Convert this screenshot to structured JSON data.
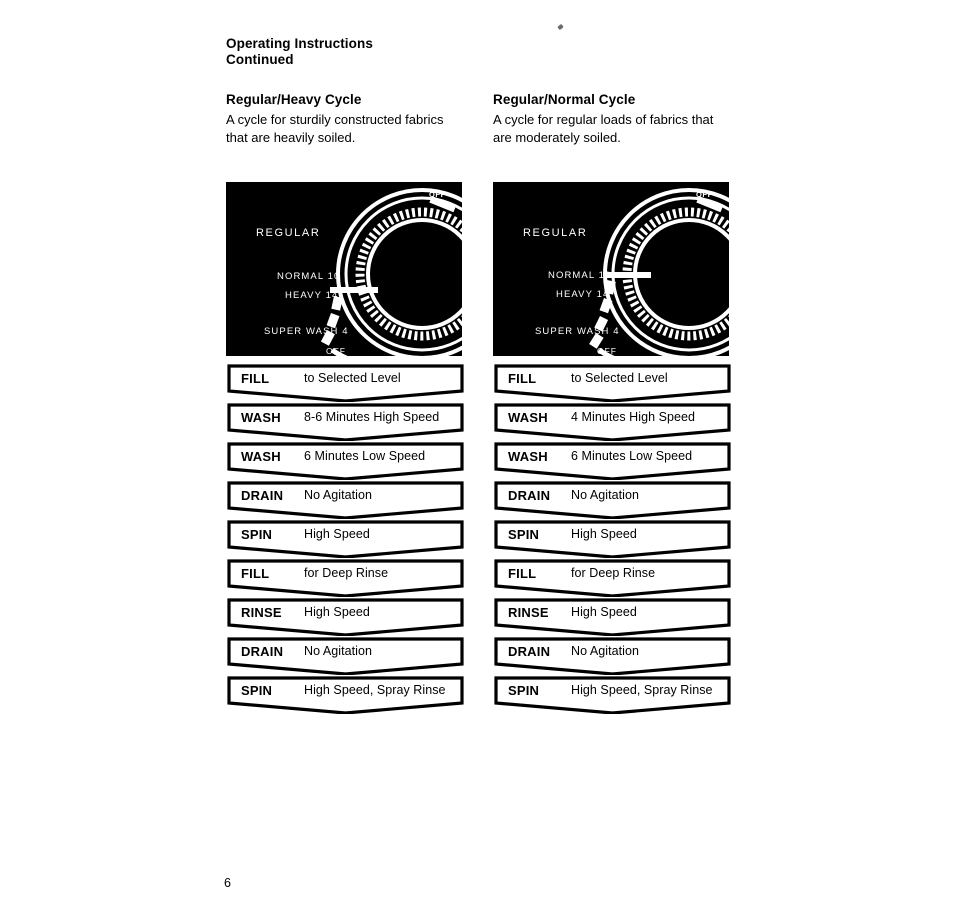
{
  "header": {
    "line1": "Operating Instructions",
    "line2": "Continued"
  },
  "columns": [
    {
      "title": "Regular/Heavy Cycle",
      "description": "A cycle for sturdily constructed fabrics that are heavily soiled.",
      "dial": {
        "brand_label": "REGULAR",
        "top_off_label": "OFF",
        "bottom_off_label": "OFF",
        "settings": [
          "NORMAL 10",
          "HEAVY 14",
          "SUPER WASH 4"
        ],
        "selected_setting": "HEAVY 14"
      },
      "steps": [
        {
          "label": "FILL",
          "value": "to Selected Level"
        },
        {
          "label": "WASH",
          "value": "8-6 Minutes High Speed"
        },
        {
          "label": "WASH",
          "value": "6 Minutes Low Speed"
        },
        {
          "label": "DRAIN",
          "value": "No Agitation"
        },
        {
          "label": "SPIN",
          "value": "High Speed"
        },
        {
          "label": "FILL",
          "value": "for Deep Rinse"
        },
        {
          "label": "RINSE",
          "value": "High Speed"
        },
        {
          "label": "DRAIN",
          "value": "No Agitation"
        },
        {
          "label": "SPIN",
          "value": "High Speed, Spray Rinse"
        }
      ]
    },
    {
      "title": "Regular/Normal Cycle",
      "description": "A cycle for regular loads of fabrics that are moderately soiled.",
      "dial": {
        "brand_label": "REGULAR",
        "top_off_label": "OFF",
        "bottom_off_label": "OFF",
        "settings": [
          "NORMAL 10",
          "HEAVY 14",
          "SUPER WASH 4"
        ],
        "selected_setting": "NORMAL 10"
      },
      "steps": [
        {
          "label": "FILL",
          "value": "to Selected Level"
        },
        {
          "label": "WASH",
          "value": "4 Minutes High Speed"
        },
        {
          "label": "WASH",
          "value": "6 Minutes Low Speed"
        },
        {
          "label": "DRAIN",
          "value": "No Agitation"
        },
        {
          "label": "SPIN",
          "value": "High Speed"
        },
        {
          "label": "FILL",
          "value": "for Deep Rinse"
        },
        {
          "label": "RINSE",
          "value": "High Speed"
        },
        {
          "label": "DRAIN",
          "value": "No Agitation"
        },
        {
          "label": "SPIN",
          "value": "High Speed, Spray Rinse"
        }
      ]
    }
  ],
  "folio": "6",
  "colors": {
    "ink": "#000000",
    "paper": "#ffffff",
    "dial_background": "#000000",
    "dial_marks": "#ffffff"
  }
}
